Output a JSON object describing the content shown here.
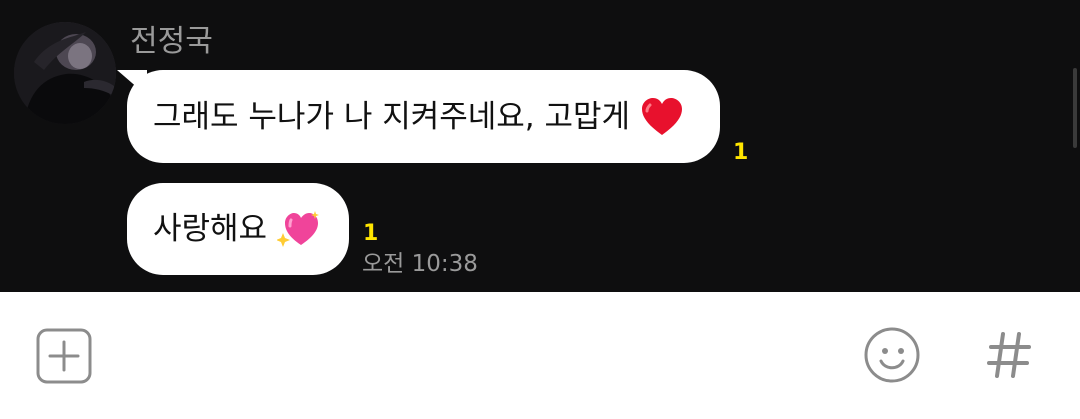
{
  "chat": {
    "sender_name": "전정국",
    "messages": [
      {
        "text": "그래도 누나가 나 지켜주네요, 고맙게",
        "emoji": "red-heart",
        "unread_count": "1"
      },
      {
        "text": "사랑해요",
        "emoji": "sparkling-heart",
        "unread_count": "1",
        "time": "오전 10:38"
      }
    ]
  },
  "input_bar": {
    "icons": [
      "plus-square-icon",
      "emoji-icon",
      "hashtag-icon"
    ]
  },
  "colors": {
    "chat_background": "#0e0e0f",
    "bubble": "#ffffff",
    "unread": "#ffe500",
    "meta_text": "#9a9a9a",
    "icon_gray": "#8c8c8c"
  }
}
